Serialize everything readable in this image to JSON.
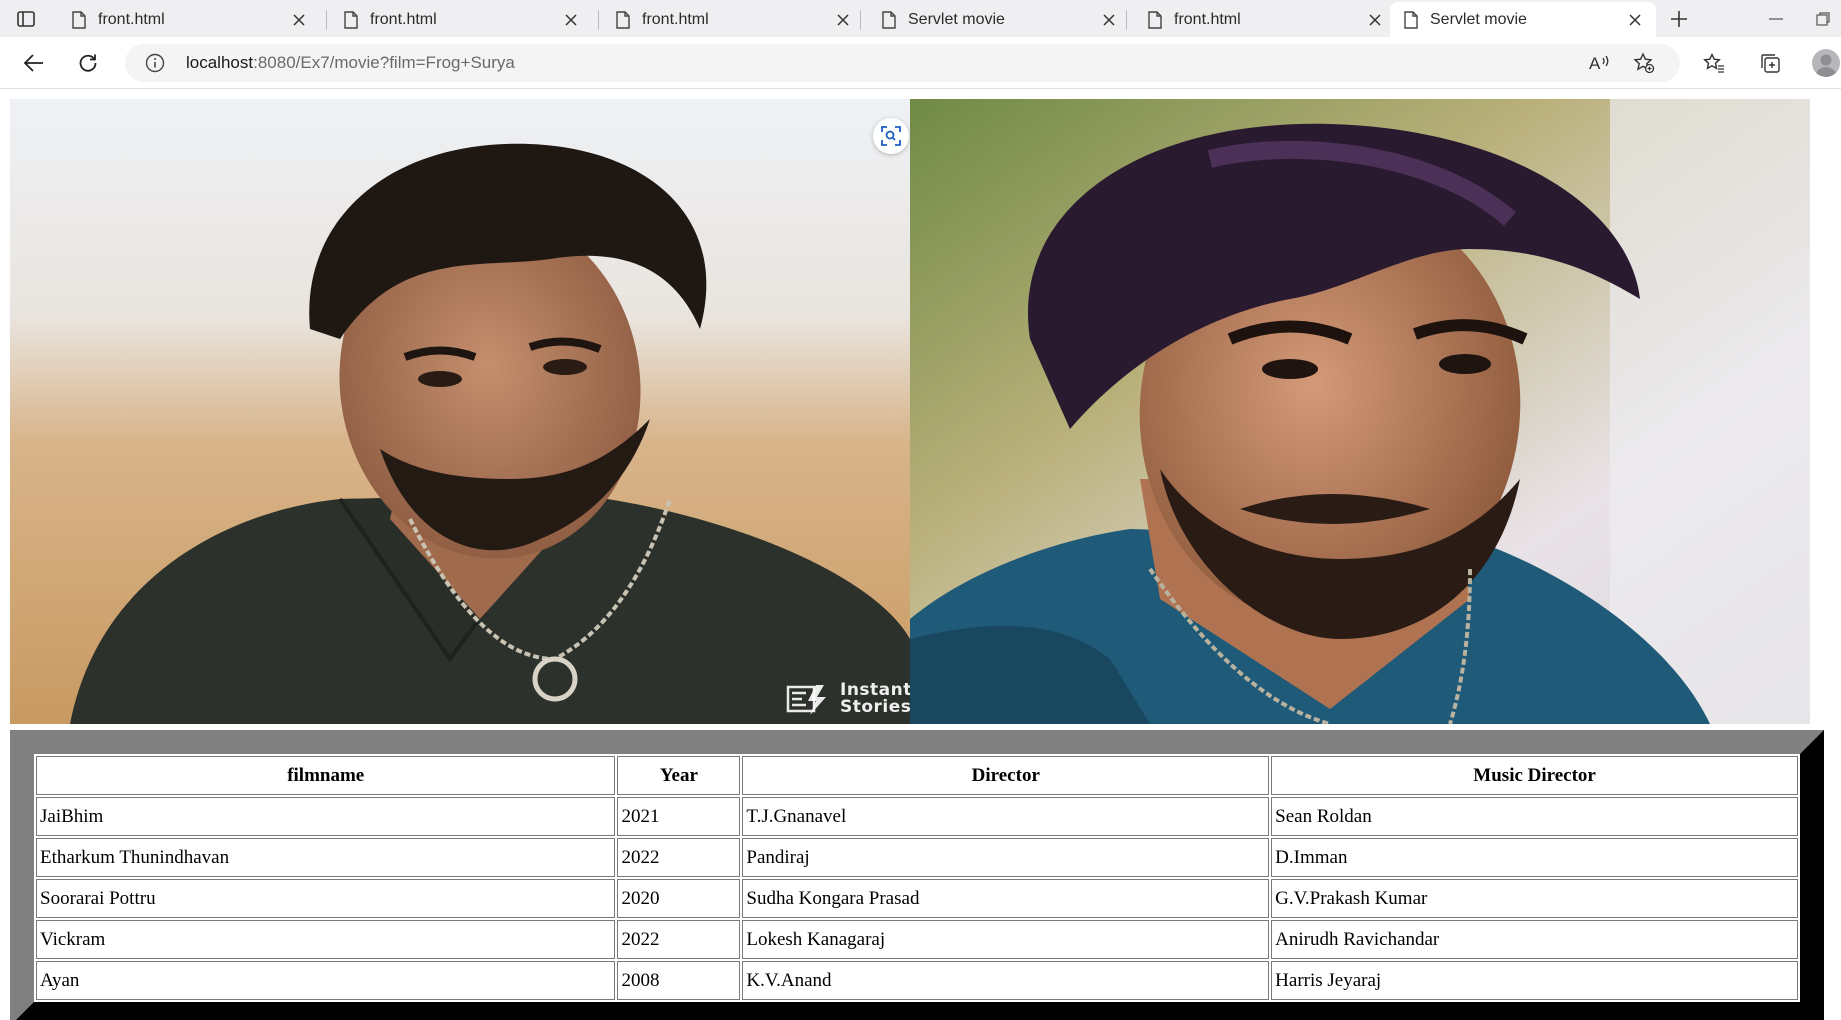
{
  "browser": {
    "tabs": [
      {
        "title": "front.html",
        "active": false
      },
      {
        "title": "front.html",
        "active": false
      },
      {
        "title": "front.html",
        "active": false
      },
      {
        "title": "Servlet movie",
        "active": false
      },
      {
        "title": "front.html",
        "active": false
      },
      {
        "title": "Servlet movie",
        "active": true
      }
    ],
    "address": {
      "host": "localhost",
      "rest": ":8080/Ex7/movie?film=Frog+Surya"
    },
    "read_aloud_label": "A",
    "colors": {
      "tabstrip": "#efeff2",
      "omnibox": "#f4f4f5"
    }
  },
  "photos": [
    {
      "name": "Actor portrait 1",
      "icon": "portrait-photo"
    },
    {
      "name": "Actor portrait 2",
      "icon": "portrait-photo"
    }
  ],
  "watermark": {
    "text": "Instant\nStories"
  },
  "table": {
    "headers": [
      "filmname",
      "Year",
      "Director",
      "Music Director"
    ],
    "rows": [
      [
        "JaiBhim",
        "2021",
        "T.J.Gnanavel",
        "Sean Roldan"
      ],
      [
        "Etharkum Thunindhavan",
        "2022",
        "Pandiraj",
        "D.Imman"
      ],
      [
        "Soorarai Pottru",
        "2020",
        "Sudha Kongara Prasad",
        "G.V.Prakash Kumar"
      ],
      [
        "Vickram",
        "2022",
        "Lokesh Kanagaraj",
        "Anirudh Ravichandar"
      ],
      [
        "Ayan",
        "2008",
        "K.V.Anand",
        "Harris Jeyaraj"
      ]
    ]
  }
}
